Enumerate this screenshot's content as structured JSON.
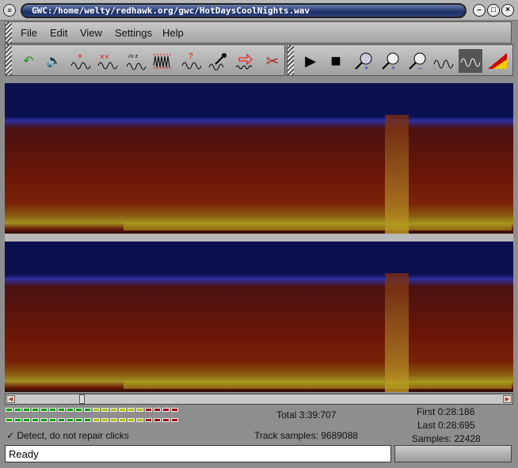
{
  "window": {
    "title": "GWC:/home/welty/redhawk.org/gwc/HotDaysCoolNights.wav",
    "sysmenu_icon": "menu-icon",
    "minimize": "–",
    "maximize": "□",
    "close": "×"
  },
  "menu": [
    "File",
    "Edit",
    "View",
    "Settings",
    "Help"
  ],
  "toolbar_left": [
    "undo-icon",
    "speaker-icon",
    "declick-icon",
    "declick-multi-icon",
    "sqrt-filter-icon",
    "declick-all-icon",
    "question-click-icon",
    "dropper-icon",
    "arrow-icon",
    "scissors-icon"
  ],
  "toolbar_right": [
    "play-icon",
    "stop-icon",
    "zoom-select-icon",
    "zoom-in-icon",
    "zoom-out-icon",
    "view-all-icon",
    "spectral-view-icon",
    "spectrogram-icon"
  ],
  "meters": {
    "colors": {
      "green": "#00a000",
      "yellow": "#b0c000",
      "red": "#a00000"
    },
    "segments": [
      10,
      6,
      4
    ]
  },
  "options": {
    "check": "✓",
    "detect_label": "Detect, do not repair clicks"
  },
  "info": {
    "total": "Total 3:39:707",
    "track_samples": "Track samples: 9689088",
    "first": "First 0:28:186",
    "last": "Last 0:28:695",
    "samples": "Samples: 22428"
  },
  "status": {
    "text": "Ready"
  },
  "scroll": {
    "position_fraction": 0.15
  }
}
